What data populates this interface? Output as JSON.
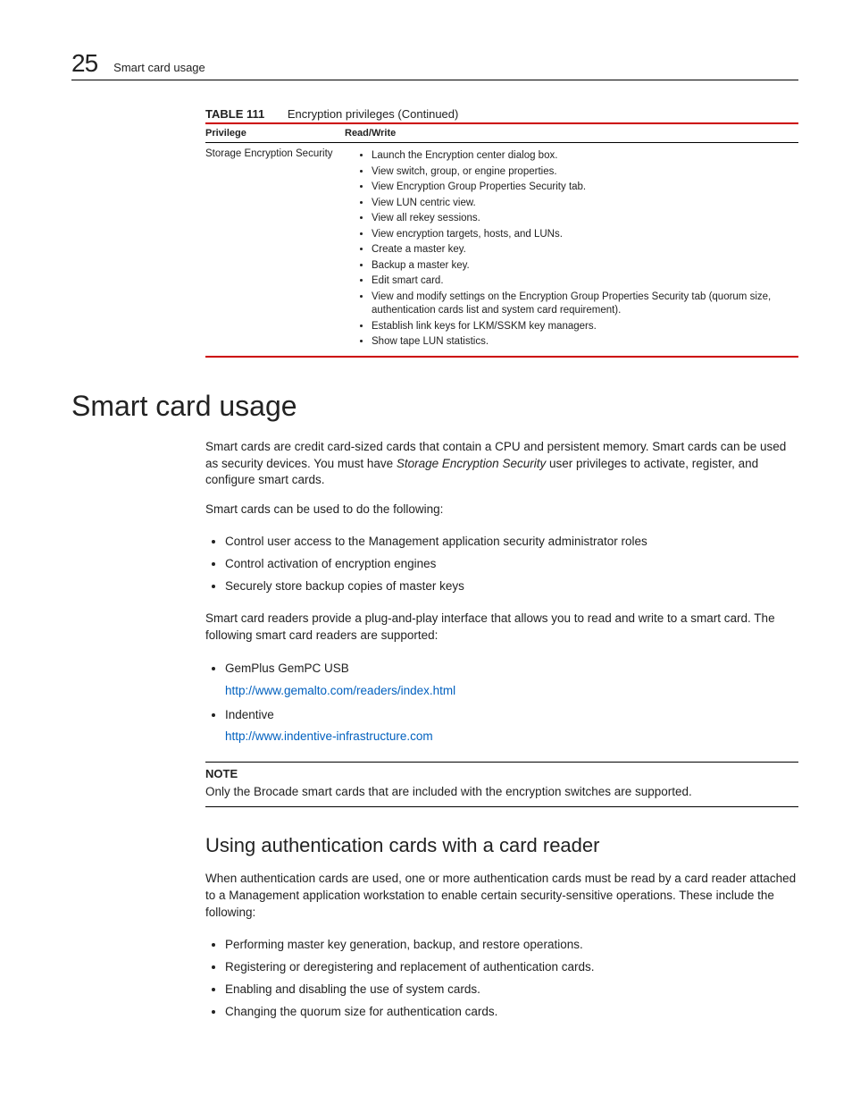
{
  "header": {
    "chapter_number": "25",
    "chapter_title": "Smart card usage"
  },
  "table": {
    "caption_label": "TABLE 111",
    "caption_text": "Encryption privileges (Continued)",
    "columns": {
      "c0": "Privilege",
      "c1": "Read/Write"
    },
    "row": {
      "privilege": "Storage Encryption Security",
      "items": [
        "Launch the Encryption center dialog box.",
        "View switch, group, or engine properties.",
        "View Encryption Group Properties Security tab.",
        "View LUN centric view.",
        "View all rekey sessions.",
        "View encryption targets, hosts, and LUNs.",
        "Create a master key.",
        "Backup a master key.",
        "Edit smart card.",
        "View and modify settings on the Encryption Group Properties Security tab (quorum size, authentication cards list and system card requirement).",
        "Establish link keys for LKM/SSKM key managers.",
        "Show tape LUN statistics."
      ]
    }
  },
  "section": {
    "title": "Smart card usage",
    "intro_pre": "Smart cards are credit card-sized cards that contain a CPU and persistent memory. Smart cards can be used as security devices. You must have ",
    "intro_em": "Storage Encryption Security",
    "intro_post": " user privileges to activate, register, and configure smart cards.",
    "lead2": "Smart cards can be used to do the following:",
    "uses": [
      "Control user access to the Management application security administrator roles",
      "Control activation of encryption engines",
      "Securely store backup copies of master keys"
    ],
    "readers_intro": "Smart card readers provide a plug-and-play interface that allows you to read and write to a smart card. The following smart card readers are supported:",
    "readers": [
      {
        "name": "GemPlus GemPC USB",
        "url": "http://www.gemalto.com/readers/index.html"
      },
      {
        "name": "Indentive",
        "url": "http://www.indentive-infrastructure.com"
      }
    ],
    "note": {
      "label": "NOTE",
      "text": "Only the Brocade smart cards that are included with the encryption switches are supported."
    },
    "subsection": {
      "title": "Using authentication cards with a card reader",
      "intro": "When authentication cards are used, one or more authentication cards must be read by a card reader attached to a Management application workstation to enable certain security-sensitive operations. These include the following:",
      "ops": [
        "Performing master key generation, backup, and restore operations.",
        "Registering or deregistering and replacement of authentication cards.",
        "Enabling and disabling the use of system cards.",
        "Changing the quorum size for authentication cards."
      ]
    }
  }
}
